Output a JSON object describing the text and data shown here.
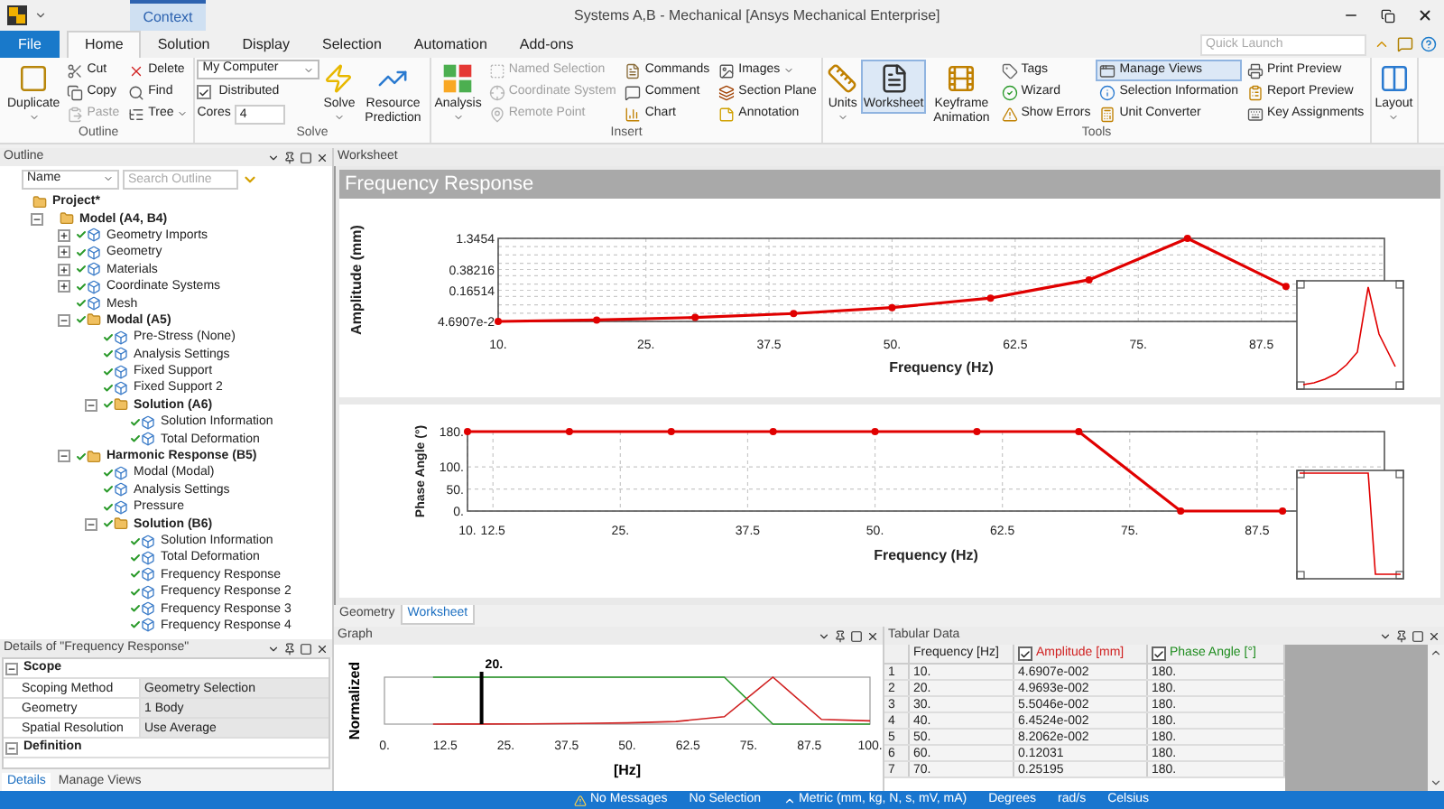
{
  "title_bar": {
    "title": "Systems A,B - Mechanical [Ansys Mechanical Enterprise]",
    "context_label": "Context"
  },
  "ribbon_tabs": [
    {
      "label": "File",
      "kind": "file",
      "selected": false
    },
    {
      "label": "Home",
      "kind": "tab",
      "selected": true
    },
    {
      "label": "Solution",
      "kind": "tab",
      "selected": false
    },
    {
      "label": "Display",
      "kind": "tab",
      "selected": false
    },
    {
      "label": "Selection",
      "kind": "tab",
      "selected": false
    },
    {
      "label": "Automation",
      "kind": "tab",
      "selected": false
    },
    {
      "label": "Add-ons",
      "kind": "tab",
      "selected": false
    }
  ],
  "quick_launch": {
    "placeholder": "Quick Launch"
  },
  "ribbon": {
    "groups": [
      {
        "label": "Outline",
        "columns": [
          [
            {
              "kind": "large",
              "label": "Duplicate",
              "caret": true,
              "disabled": false,
              "selected": false
            }
          ],
          [
            {
              "kind": "small",
              "label": "Cut",
              "disabled": false,
              "selected": false
            },
            {
              "kind": "small",
              "label": "Copy",
              "disabled": false,
              "selected": false
            },
            {
              "kind": "small",
              "label": "Paste",
              "disabled": true,
              "selected": false
            }
          ],
          [
            {
              "kind": "small",
              "label": "Delete",
              "disabled": false,
              "selected": false
            },
            {
              "kind": "small",
              "label": "Find",
              "disabled": false,
              "selected": false
            },
            {
              "kind": "small",
              "label": "Tree",
              "caret": true,
              "disabled": false,
              "selected": false
            }
          ]
        ]
      },
      {
        "label": "Solve",
        "columns": [
          [
            {
              "kind": "select",
              "value": "My Computer"
            },
            {
              "kind": "checkbox",
              "label": "Distributed",
              "checked": true
            },
            {
              "kind": "field",
              "label": "Cores",
              "value": "4"
            }
          ],
          [
            {
              "kind": "large",
              "label": "Solve",
              "caret": true,
              "disabled": false,
              "selected": false
            }
          ],
          [
            {
              "kind": "large",
              "label": "Resource Prediction",
              "disabled": false,
              "selected": false
            }
          ]
        ]
      },
      {
        "label": "Insert",
        "columns": [
          [
            {
              "kind": "large",
              "label": "Analysis",
              "caret": true,
              "disabled": false,
              "selected": false
            }
          ],
          [
            {
              "kind": "small",
              "label": "Named Selection",
              "disabled": true,
              "selected": false
            },
            {
              "kind": "small",
              "label": "Coordinate System",
              "disabled": true,
              "selected": false
            },
            {
              "kind": "small",
              "label": "Remote Point",
              "disabled": true,
              "selected": false
            }
          ],
          [
            {
              "kind": "small",
              "label": "Commands",
              "disabled": false,
              "selected": false
            },
            {
              "kind": "small",
              "label": "Comment",
              "disabled": false,
              "selected": false
            },
            {
              "kind": "small",
              "label": "Chart",
              "disabled": false,
              "selected": false
            }
          ],
          [
            {
              "kind": "small",
              "label": "Images",
              "caret": true,
              "disabled": false,
              "selected": false
            },
            {
              "kind": "small",
              "label": "Section Plane",
              "disabled": false,
              "selected": false
            },
            {
              "kind": "small",
              "label": "Annotation",
              "disabled": false,
              "selected": false
            }
          ]
        ]
      },
      {
        "label": "Tools",
        "columns": [
          [
            {
              "kind": "large",
              "label": "Units",
              "caret": true,
              "disabled": false,
              "selected": false
            }
          ],
          [
            {
              "kind": "large",
              "label": "Worksheet",
              "disabled": false,
              "selected": true
            }
          ],
          [
            {
              "kind": "large",
              "label": "Keyframe Animation",
              "disabled": false,
              "selected": false
            }
          ],
          [
            {
              "kind": "small",
              "label": "Tags",
              "disabled": false,
              "selected": false
            },
            {
              "kind": "small",
              "label": "Wizard",
              "disabled": false,
              "selected": false
            },
            {
              "kind": "small",
              "label": "Show Errors",
              "disabled": false,
              "selected": false
            }
          ],
          [
            {
              "kind": "small",
              "label": "Manage Views",
              "disabled": false,
              "selected": true
            },
            {
              "kind": "small",
              "label": "Selection Information",
              "disabled": false,
              "selected": false
            },
            {
              "kind": "small",
              "label": "Unit Converter",
              "disabled": false,
              "selected": false
            }
          ],
          [
            {
              "kind": "small",
              "label": "Print Preview",
              "disabled": false,
              "selected": false
            },
            {
              "kind": "small",
              "label": "Report Preview",
              "disabled": false,
              "selected": false
            },
            {
              "kind": "small",
              "label": "Key Assignments",
              "disabled": false,
              "selected": false
            }
          ]
        ]
      },
      {
        "columns": [
          [
            {
              "kind": "large",
              "label": "Layout",
              "caret": true,
              "disabled": false,
              "selected": false
            }
          ]
        ]
      }
    ]
  },
  "outline": {
    "title": "Outline",
    "filter": {
      "value": "Name"
    },
    "search": {
      "placeholder": "Search Outline"
    },
    "tree": [
      {
        "label": "Project*",
        "bold": true,
        "solved": false,
        "children": [
          {
            "label": "Model (A4, B4)",
            "bold": true,
            "solved": false,
            "expanded": true,
            "children": [
              {
                "label": "Geometry Imports",
                "solved": true,
                "expanded": false
              },
              {
                "label": "Geometry",
                "solved": true,
                "expanded": false
              },
              {
                "label": "Materials",
                "solved": true,
                "expanded": false
              },
              {
                "label": "Coordinate Systems",
                "solved": true,
                "expanded": false
              },
              {
                "label": "Mesh",
                "solved": true
              },
              {
                "label": "Modal (A5)",
                "bold": true,
                "solved": true,
                "expanded": true,
                "children": [
                  {
                    "label": "Pre-Stress (None)",
                    "solved": true
                  },
                  {
                    "label": "Analysis Settings",
                    "solved": true
                  },
                  {
                    "label": "Fixed Support",
                    "solved": true
                  },
                  {
                    "label": "Fixed Support 2",
                    "solved": true
                  },
                  {
                    "label": "Solution (A6)",
                    "bold": true,
                    "solved": true,
                    "expanded": true,
                    "children": [
                      {
                        "label": "Solution Information",
                        "solved": true
                      },
                      {
                        "label": "Total Deformation",
                        "solved": true
                      }
                    ]
                  }
                ]
              },
              {
                "label": "Harmonic Response (B5)",
                "bold": true,
                "solved": true,
                "expanded": true,
                "children": [
                  {
                    "label": "Modal (Modal)",
                    "solved": true
                  },
                  {
                    "label": "Analysis Settings",
                    "solved": true
                  },
                  {
                    "label": "Pressure",
                    "solved": true
                  },
                  {
                    "label": "Solution (B6)",
                    "bold": true,
                    "solved": true,
                    "expanded": true,
                    "children": [
                      {
                        "label": "Solution Information",
                        "solved": true
                      },
                      {
                        "label": "Total Deformation",
                        "solved": true
                      },
                      {
                        "label": "Frequency Response",
                        "solved": true
                      },
                      {
                        "label": "Frequency Response 2",
                        "solved": true
                      },
                      {
                        "label": "Frequency Response 3",
                        "solved": true
                      },
                      {
                        "label": "Frequency Response 4",
                        "solved": true
                      }
                    ]
                  }
                ]
              }
            ]
          }
        ]
      }
    ]
  },
  "details": {
    "title": "Details of \"Frequency Response\"",
    "sections": [
      {
        "label": "Scope",
        "expanded": true,
        "rows": [
          {
            "name": "Scoping Method",
            "value": "Geometry Selection"
          },
          {
            "name": "Geometry",
            "value": "1 Body"
          },
          {
            "name": "Spatial Resolution",
            "value": "Use Average"
          }
        ]
      },
      {
        "label": "Definition",
        "expanded": true
      }
    ],
    "tabs": [
      {
        "label": "Details",
        "selected": true
      },
      {
        "label": "Manage Views",
        "selected": false
      }
    ]
  },
  "worksheet": {
    "panel_title": "Worksheet",
    "heading": "Frequency Response",
    "amplitude_chart": {
      "xlabel": "Frequency (Hz)",
      "ylabel": "Amplitude (mm)",
      "x_tick_labels": [
        "10.",
        "25.",
        "37.5",
        "50.",
        "62.5",
        "75.",
        "87.5"
      ],
      "y_tick_labels": [
        "1.3454",
        "0.38216",
        "0.16514",
        "4.6907e-2"
      ]
    },
    "phase_chart": {
      "chart_data": {
        "type": "line",
        "xlabel": "Frequency (Hz)",
        "ylabel": "Phase Angle (°)",
        "x": [
          10,
          20,
          30,
          40,
          50,
          60,
          70,
          80,
          90
        ],
        "series": [
          {
            "color": "#e00000",
            "marker": true,
            "values": [
              180,
              180,
              180,
              180,
              180,
              180,
              180,
              0,
              0
            ]
          }
        ],
        "xlim": [
          10,
          100
        ],
        "ylim": [
          0,
          180
        ],
        "grid": true,
        "xticks": [
          {
            "value": 10,
            "label": "10."
          },
          {
            "value": 12.5,
            "label": "12.5"
          },
          {
            "value": 25,
            "label": "25."
          },
          {
            "value": 37.5,
            "label": "37.5"
          },
          {
            "value": 50,
            "label": "50."
          },
          {
            "value": 62.5,
            "label": "62.5"
          },
          {
            "value": 75,
            "label": "75."
          },
          {
            "value": 87.5,
            "label": "87.5"
          }
        ],
        "yticks": [
          {
            "value": 0,
            "label": "0."
          },
          {
            "value": 50,
            "label": "50."
          },
          {
            "value": 100,
            "label": "100."
          },
          {
            "value": 180,
            "label": "180."
          }
        ]
      }
    }
  },
  "view_tabs": [
    {
      "label": "Geometry",
      "selected": false
    },
    {
      "label": "Worksheet",
      "selected": true
    }
  ],
  "graph": {
    "title": "Graph",
    "ylabel": "Normalized",
    "xlabel": "[Hz]",
    "marker_label": "20.",
    "x_tick_labels": [
      "0.",
      "12.5",
      "25.",
      "37.5",
      "50.",
      "62.5",
      "75.",
      "87.5",
      "100."
    ]
  },
  "tabular_data": {
    "title": "Tabular Data",
    "columns": [
      {
        "label": "Frequency [Hz]"
      },
      {
        "label": "Amplitude [mm]",
        "checked": true,
        "color": "#d02020"
      },
      {
        "label": "Phase Angle [°]",
        "checked": true,
        "color": "#1e8c1e"
      }
    ],
    "rows": [
      {
        "index": "1",
        "cells": [
          "10.",
          "4.6907e-002",
          "180."
        ]
      },
      {
        "index": "2",
        "cells": [
          "20.",
          "4.9693e-002",
          "180."
        ]
      },
      {
        "index": "3",
        "cells": [
          "30.",
          "5.5046e-002",
          "180."
        ]
      },
      {
        "index": "4",
        "cells": [
          "40.",
          "6.4524e-002",
          "180."
        ]
      },
      {
        "index": "5",
        "cells": [
          "50.",
          "8.2062e-002",
          "180."
        ]
      },
      {
        "index": "6",
        "cells": [
          "60.",
          "0.12031",
          "180."
        ]
      },
      {
        "index": "7",
        "cells": [
          "70.",
          "0.25195",
          "180."
        ]
      }
    ]
  },
  "status_bar": {
    "messages": "No Messages",
    "selection": "No Selection",
    "unit_system": "Metric (mm, kg, N, s, mV, mA)",
    "angle": "Degrees",
    "rotational_velocity": "rad/s",
    "temperature": "Celsius"
  }
}
